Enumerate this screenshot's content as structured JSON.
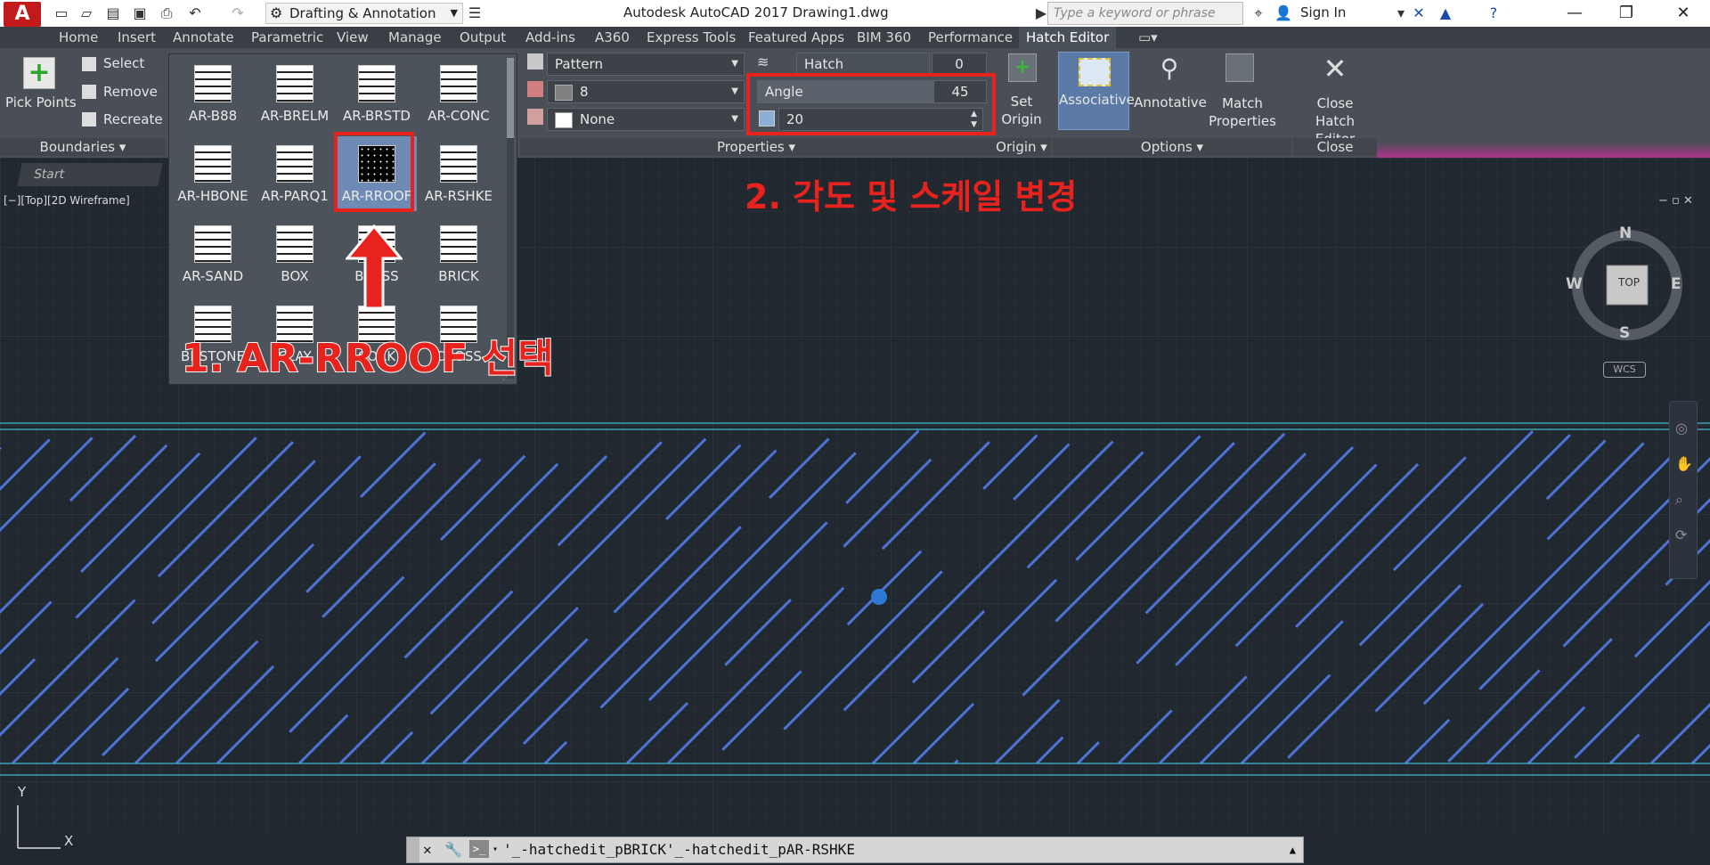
{
  "app": {
    "logo": "A",
    "title": "Autodesk AutoCAD 2017    Drawing1.dwg",
    "workspace": "Drafting & Annotation",
    "search_placeholder": "Type a keyword or phrase",
    "signin": "Sign In"
  },
  "ribbon_tabs": [
    "Home",
    "Insert",
    "Annotate",
    "Parametric",
    "View",
    "Manage",
    "Output",
    "Add-ins",
    "A360",
    "Express Tools",
    "Featured Apps",
    "BIM 360",
    "Performance",
    "Hatch Editor"
  ],
  "boundaries": {
    "pick_points": "Pick Points",
    "select": "Select",
    "remove": "Remove",
    "recreate": "Recreate",
    "panel_label": "Boundaries"
  },
  "pattern_gallery": {
    "patterns": [
      "AR-B88",
      "AR-BRELM",
      "AR-BRSTD",
      "AR-CONC",
      "AR-HBONE",
      "AR-PARQ1",
      "AR-RROOF",
      "AR-RSHKE",
      "AR-SAND",
      "BOX",
      "BRASS",
      "BRICK",
      "BRSTONE",
      "CLAY",
      "CORK",
      "CROSS"
    ],
    "selected": "AR-RROOF"
  },
  "properties": {
    "type": "Pattern",
    "color": "8",
    "background": "None",
    "transparency_label": "Hatch Transparency",
    "transparency_value": "0",
    "angle_label": "Angle",
    "angle_value": "45",
    "scale_value": "20",
    "panel_label": "Properties"
  },
  "origin": {
    "set_origin": "Set Origin",
    "panel_label": "Origin"
  },
  "options": {
    "associative": "Associative",
    "annotative": "Annotative",
    "match_properties": "Match Properties",
    "panel_label": "Options"
  },
  "close": {
    "close_hatch_editor": "Close Hatch Editor",
    "panel_label": "Close"
  },
  "drawing": {
    "start_tab": "Start",
    "viewport_label": "[−][Top][2D Wireframe]",
    "viewcube": {
      "top": "TOP",
      "n": "N",
      "s": "S",
      "e": "E",
      "w": "W"
    },
    "wcs": "WCS",
    "ucs_y": "Y",
    "ucs_x": "X"
  },
  "command_line": "'_-hatchedit_pBRICK'_-hatchedit_pAR-RSHKE",
  "annotations": {
    "step1": "1. AR-RROOF 선택",
    "step2": "2. 각도 및 스케일 변경"
  },
  "colors": {
    "accent_red": "#e8221c",
    "hatch_line": "#4c74d6",
    "boundary_line": "#3fb7d4",
    "canvas_bg": "#212830",
    "ribbon_bg": "#4a4f57"
  }
}
